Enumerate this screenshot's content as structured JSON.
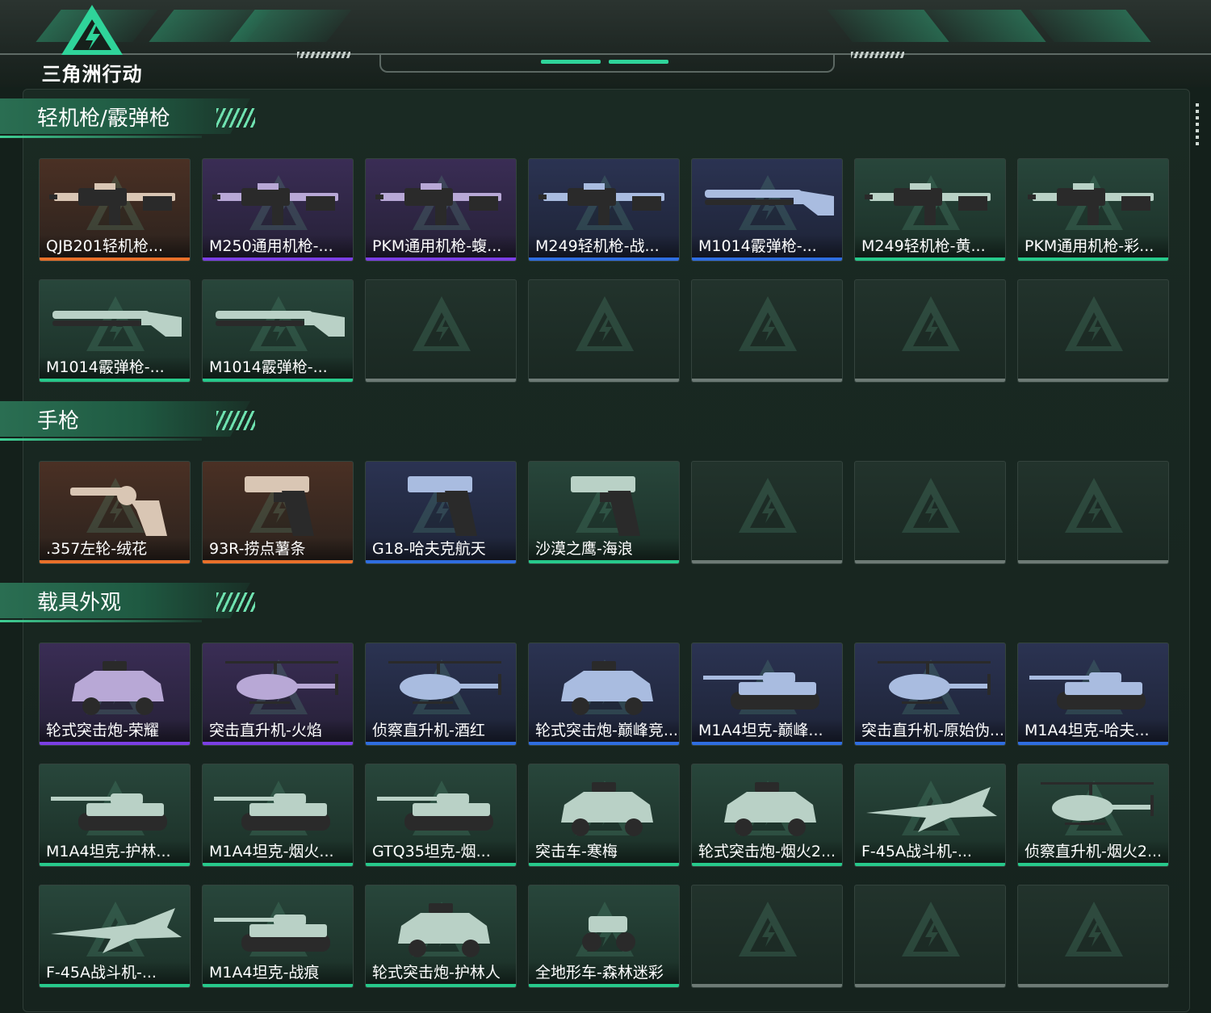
{
  "header": {
    "game_logo_text": "三角洲行动"
  },
  "colors": {
    "orange": "#e8702a",
    "purple": "#7b3fe4",
    "blue": "#2f6de0",
    "green": "#27c98b",
    "accent": "#2fd49a"
  },
  "sections": [
    {
      "title": "轻机枪/霰弹枪",
      "items": [
        {
          "name": "QJB201轻机枪...",
          "rarity": "orange",
          "icon": "lmg-icon"
        },
        {
          "name": "M250通用机枪-...",
          "rarity": "purple",
          "icon": "lmg-icon"
        },
        {
          "name": "PKM通用机枪-蝮...",
          "rarity": "purple",
          "icon": "lmg-icon"
        },
        {
          "name": "M249轻机枪-战...",
          "rarity": "blue",
          "icon": "lmg-icon"
        },
        {
          "name": "M1014霰弹枪-...",
          "rarity": "blue",
          "icon": "shotgun-icon"
        },
        {
          "name": "M249轻机枪-黄...",
          "rarity": "green",
          "icon": "lmg-icon"
        },
        {
          "name": "PKM通用机枪-彩...",
          "rarity": "green",
          "icon": "lmg-icon"
        },
        {
          "name": "M1014霰弹枪-...",
          "rarity": "green",
          "icon": "shotgun-icon"
        },
        {
          "name": "M1014霰弹枪-...",
          "rarity": "green",
          "icon": "shotgun-icon"
        },
        {
          "name": "",
          "rarity": "empty"
        },
        {
          "name": "",
          "rarity": "empty"
        },
        {
          "name": "",
          "rarity": "empty"
        },
        {
          "name": "",
          "rarity": "empty"
        },
        {
          "name": "",
          "rarity": "empty"
        }
      ]
    },
    {
      "title": "手枪",
      "items": [
        {
          "name": ".357左轮-绒花",
          "rarity": "orange",
          "icon": "revolver-icon"
        },
        {
          "name": "93R-捞点薯条",
          "rarity": "orange",
          "icon": "pistol-icon"
        },
        {
          "name": "G18-哈夫克航天",
          "rarity": "blue",
          "icon": "pistol-icon"
        },
        {
          "name": "沙漠之鹰-海浪",
          "rarity": "green",
          "icon": "pistol-icon"
        },
        {
          "name": "",
          "rarity": "empty"
        },
        {
          "name": "",
          "rarity": "empty"
        },
        {
          "name": "",
          "rarity": "empty"
        }
      ]
    },
    {
      "title": "载具外观",
      "items": [
        {
          "name": "轮式突击炮-荣耀",
          "rarity": "purple",
          "icon": "armored-car-icon"
        },
        {
          "name": "突击直升机-火焰",
          "rarity": "purple",
          "icon": "helicopter-icon"
        },
        {
          "name": "侦察直升机-酒红",
          "rarity": "blue",
          "icon": "helicopter-icon"
        },
        {
          "name": "轮式突击炮-巅峰竞...",
          "rarity": "blue",
          "icon": "armored-car-icon"
        },
        {
          "name": "M1A4坦克-巅峰...",
          "rarity": "blue",
          "icon": "tank-icon"
        },
        {
          "name": "突击直升机-原始伪...",
          "rarity": "blue",
          "icon": "helicopter-icon"
        },
        {
          "name": "M1A4坦克-哈夫...",
          "rarity": "blue",
          "icon": "tank-icon"
        },
        {
          "name": "M1A4坦克-护林...",
          "rarity": "green",
          "icon": "tank-icon"
        },
        {
          "name": "M1A4坦克-烟火...",
          "rarity": "green",
          "icon": "tank-icon"
        },
        {
          "name": "GTQ35坦克-烟...",
          "rarity": "green",
          "icon": "tank-icon"
        },
        {
          "name": "突击车-寒梅",
          "rarity": "green",
          "icon": "armored-car-icon"
        },
        {
          "name": "轮式突击炮-烟火2...",
          "rarity": "green",
          "icon": "armored-car-icon"
        },
        {
          "name": "F-45A战斗机-...",
          "rarity": "green",
          "icon": "jet-icon"
        },
        {
          "name": "侦察直升机-烟火2...",
          "rarity": "green",
          "icon": "helicopter-icon"
        },
        {
          "name": "F-45A战斗机-...",
          "rarity": "green",
          "icon": "jet-icon"
        },
        {
          "name": "M1A4坦克-战痕",
          "rarity": "green",
          "icon": "tank-icon"
        },
        {
          "name": "轮式突击炮-护林人",
          "rarity": "green",
          "icon": "armored-car-icon"
        },
        {
          "name": "全地形车-森林迷彩",
          "rarity": "green",
          "icon": "atv-icon"
        },
        {
          "name": "",
          "rarity": "empty"
        },
        {
          "name": "",
          "rarity": "empty"
        },
        {
          "name": "",
          "rarity": "empty"
        }
      ]
    }
  ]
}
